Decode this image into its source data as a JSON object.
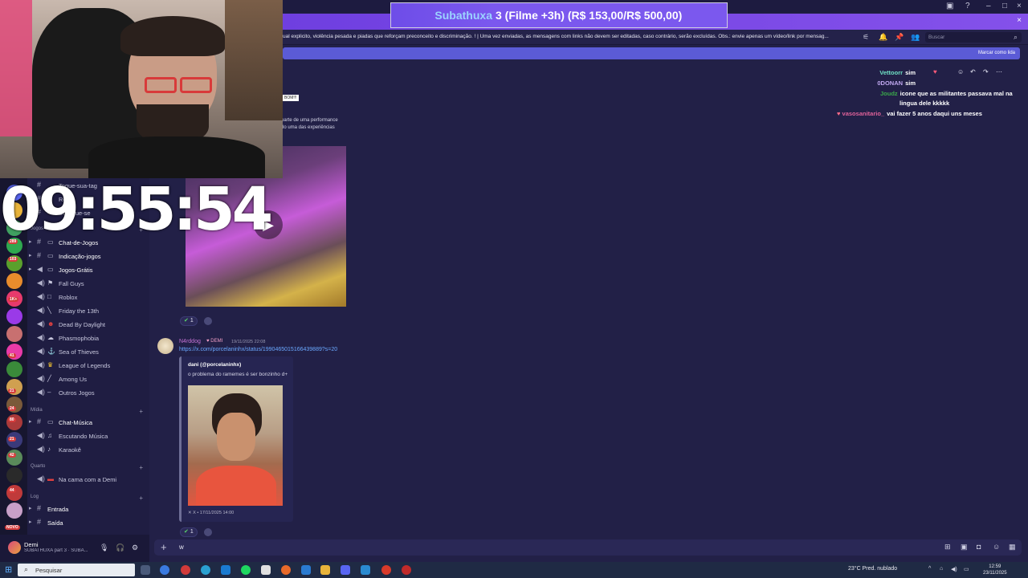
{
  "sub_banner": {
    "name": "Subathuxa",
    "text": "3 (Filme +3h) (R$ 153,00/R$ 500,00)"
  },
  "timer": "09:55:54",
  "channel_header": {
    "topic": "ual explicito, violência pesada e piadas que reforçam preconceito e discriminação. ! | Uma vez enviadas, as mensagens com links não devem ser editadas, caso contrário, serão excluídas. Obs.: envie apenas um vídeo/link por mensag...",
    "search_placeholder": "Buscar",
    "mark_read": "Marcar como lida"
  },
  "servers": {
    "badges": [
      "289",
      "103",
      "1K+",
      "41",
      "21",
      "24",
      "80",
      "21",
      "42",
      "44",
      "NOVO"
    ]
  },
  "channels": [
    {
      "label": "Toque-sua-tag",
      "type": "text",
      "bold": false
    },
    {
      "label": "Rea",
      "type": "text",
      "bold": false
    },
    {
      "label": "Divulgue-se",
      "type": "text",
      "bold": false
    },
    {
      "label": "Chat-de-Jogos",
      "type": "text",
      "bold": true
    },
    {
      "label": "Indicação-jogos",
      "type": "text",
      "bold": true
    },
    {
      "label": "Jogos-Grátis",
      "type": "announce",
      "bold": true
    },
    {
      "label": "Fall Guys",
      "type": "voice",
      "bold": false
    },
    {
      "label": "Roblox",
      "type": "voice",
      "bold": false
    },
    {
      "label": "Friday the 13th",
      "type": "voice",
      "bold": false
    },
    {
      "label": "Dead By Daylight",
      "type": "voice",
      "bold": false
    },
    {
      "label": "Phasmophobia",
      "type": "voice",
      "bold": false
    },
    {
      "label": "Sea of Thieves",
      "type": "voice",
      "bold": false
    },
    {
      "label": "League of Legends",
      "type": "voice",
      "bold": false
    },
    {
      "label": "Among Us",
      "type": "voice",
      "bold": false
    },
    {
      "label": "Outros Jogos",
      "type": "voice",
      "bold": false
    },
    {
      "label": "Chat-Música",
      "type": "text",
      "bold": true
    },
    {
      "label": "Escutando Música",
      "type": "voice",
      "bold": false
    },
    {
      "label": "Karaokê",
      "type": "voice",
      "bold": false
    },
    {
      "label": "Na cama com a Demi",
      "type": "voice",
      "bold": false
    },
    {
      "label": "Entrada",
      "type": "text",
      "bold": true
    },
    {
      "label": "Saída",
      "type": "text",
      "bold": true
    }
  ],
  "categories": {
    "jogos": "Jogos",
    "midia": "Mídia",
    "quarto": "Quarto",
    "log": "Log"
  },
  "user": {
    "name": "Demi",
    "status": "SUBATHUXA part 3 · SUBA..."
  },
  "embed1": {
    "tag": "BOM!!!",
    "line1": "parte de uma performance",
    "line2": "do uma das experiências",
    "reaction_count": "1"
  },
  "message": {
    "author": "N4rddog",
    "badge": "DEMI",
    "timestamp": "19/11/2025 22:08",
    "link": "https://x.com/porcelaninhx/status/1990465015166439889?s=20",
    "embed_author": "dani (@porcelaninhx)",
    "embed_text": "o problema do ramemes é ser bonzinho d+",
    "embed_footer": "X • 17/11/2025 14:00",
    "reaction_count": "1"
  },
  "chat": [
    {
      "name": "Vettoorr",
      "text": "sim",
      "color": "#6fe0c4"
    },
    {
      "name": "0DONAN",
      "text": "sim",
      "color": "#c0a8f0"
    },
    {
      "name": "Joudz",
      "text": "icone que as militantes passava mal na",
      "text2": "lingua dele kkkkk",
      "color": "#3aa84a"
    },
    {
      "name": "vasosanitario_",
      "text": "vai fazer 5 anos daqui uns meses",
      "color": "#e0629a"
    }
  ],
  "composer": {
    "text": "w"
  },
  "taskbar": {
    "search": "Pesquisar",
    "weather": "23°C  Pred. nublado",
    "time": "12:59",
    "date": "23/11/2025"
  },
  "colors": {
    "accent": "#7b58ee",
    "background": "#222047",
    "link": "#6aa8ff"
  }
}
